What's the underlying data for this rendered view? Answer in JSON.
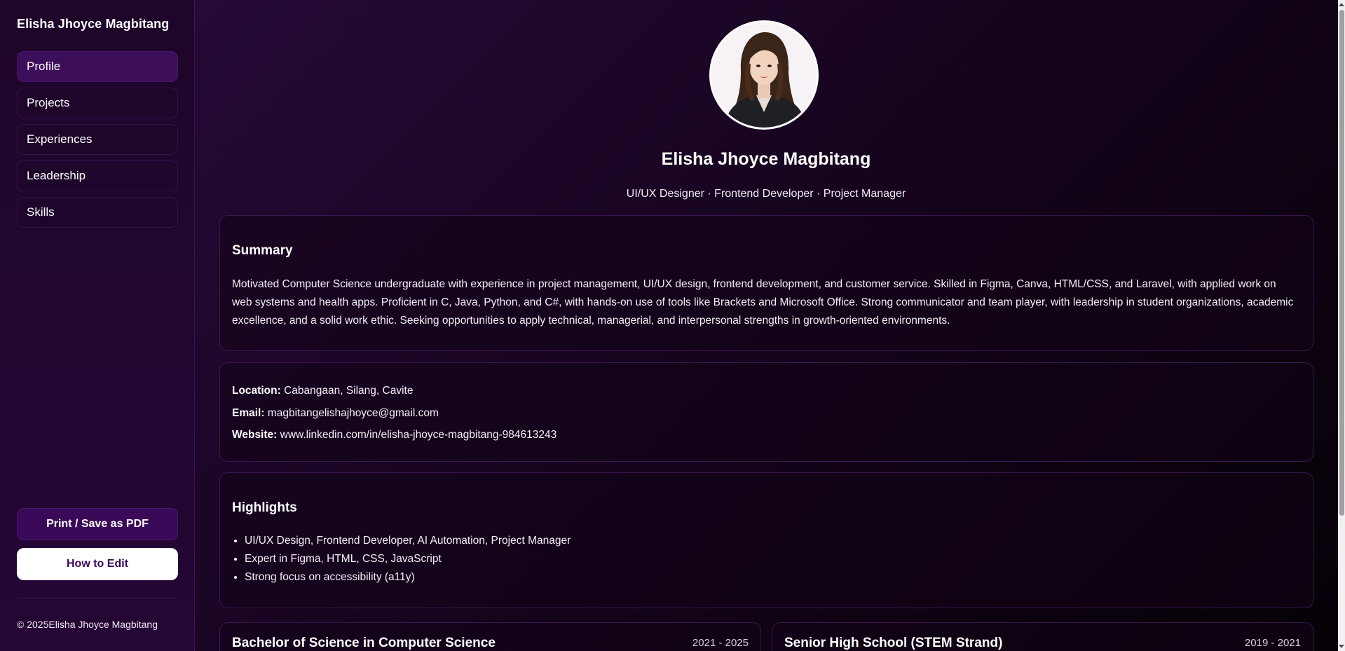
{
  "sidebar": {
    "brand": "Elisha Jhoyce Magbitang",
    "items": [
      {
        "label": "Profile"
      },
      {
        "label": "Projects"
      },
      {
        "label": "Experiences"
      },
      {
        "label": "Leadership"
      },
      {
        "label": "Skills"
      }
    ],
    "print_label": "Print / Save as PDF",
    "edit_label": "How to Edit",
    "copyright": "© 2025Elisha Jhoyce Magbitang"
  },
  "profile": {
    "name": "Elisha Jhoyce Magbitang",
    "tagline": "UI/UX Designer · Frontend Developer · Project Manager"
  },
  "summary": {
    "heading": "Summary",
    "text": "Motivated Computer Science undergraduate with experience in project management, UI/UX design, frontend development, and customer service. Skilled in Figma, Canva, HTML/CSS, and Laravel, with applied work on web systems and health apps. Proficient in C, Java, Python, and C#, with hands-on use of tools like Brackets and Microsoft Office. Strong communicator and team player, with leadership in student organizations, academic excellence, and a solid work ethic. Seeking opportunities to apply technical, managerial, and interpersonal strengths in growth-oriented environments."
  },
  "contact": {
    "location_label": "Location:",
    "location": "Cabangaan, Silang, Cavite",
    "email_label": "Email:",
    "email": "magbitangelishajhoyce@gmail.com",
    "website_label": "Website:",
    "website": "www.linkedin.com/in/elisha-jhoyce-magbitang-984613243"
  },
  "highlights": {
    "heading": "Highlights",
    "items": [
      "UI/UX Design, Frontend Developer, AI Automation, Project Manager",
      "Expert in Figma, HTML, CSS, JavaScript",
      "Strong focus on accessibility (a11y)"
    ]
  },
  "education": [
    {
      "title": "Bachelor of Science in Computer Science",
      "years": "2021 - 2025"
    },
    {
      "title": "Senior High School (STEM Strand)",
      "years": "2019 - 2021"
    }
  ],
  "colors": {
    "accent": "#3a0a58",
    "sidebar_bg": "#220630",
    "card_border": "#3a1650"
  }
}
